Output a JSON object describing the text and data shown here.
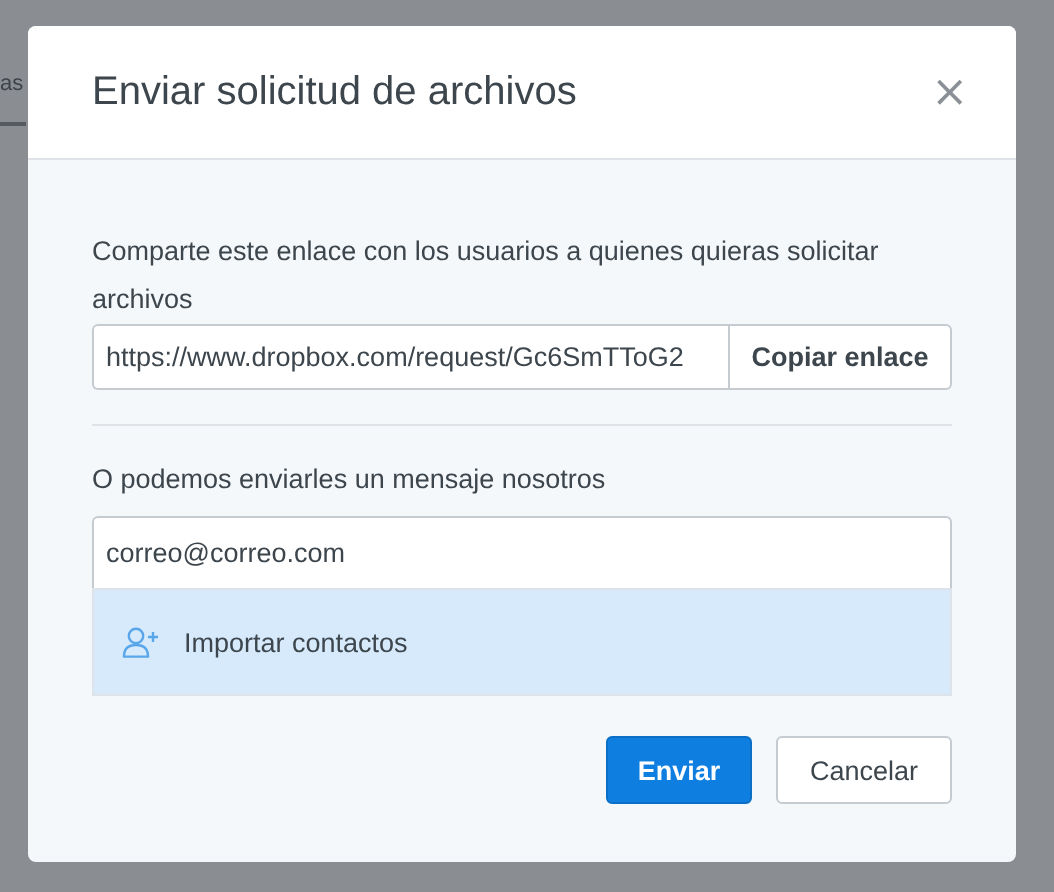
{
  "backdrop": {
    "tab_fragment": "as"
  },
  "dialog": {
    "title": "Enviar solicitud de archivos",
    "close": "×",
    "share_label": "Comparte este enlace con los usuarios a quienes quieras solicitar archivos",
    "link": {
      "value": "https://www.dropbox.com/request/Gc6SmTToG2",
      "button": "Copiar enlace"
    },
    "email_label": "O podemos enviarles un mensaje nosotros",
    "email": {
      "value": "correo@correo.com"
    },
    "suggestion": {
      "label": "Importar contactos",
      "selected": true
    },
    "buttons": [
      {
        "label": "Enviar",
        "kind": "primary"
      },
      {
        "label": "Cancelar",
        "kind": "secondary"
      }
    ]
  }
}
